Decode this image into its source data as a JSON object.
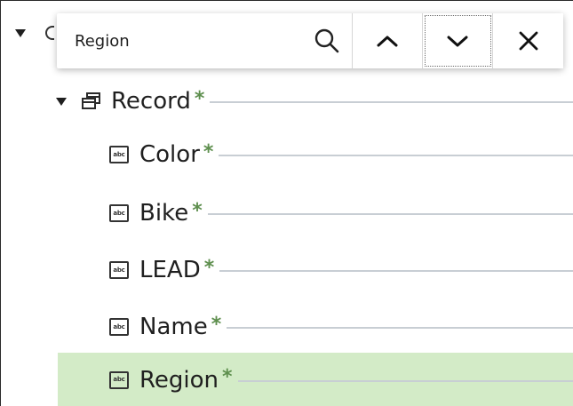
{
  "colors": {
    "selected_row": "#d3ebc7",
    "required_asterisk": "#5e8f4e",
    "leader_line": "#c8ced4"
  },
  "find_bar": {
    "value": "Region",
    "search_icon": "search-icon",
    "prev_icon": "chevron-up-icon",
    "next_icon": "chevron-down-icon",
    "close_icon": "close-icon"
  },
  "tree": {
    "root": {
      "expanded": true
    },
    "record": {
      "label": "Record",
      "required": "*",
      "icon": "record-icon",
      "expanded": true
    },
    "fields": [
      {
        "label": "Color",
        "required": "*",
        "icon": "abc-icon",
        "icon_text": "abc"
      },
      {
        "label": "Bike",
        "required": "*",
        "icon": "abc-icon",
        "icon_text": "abc"
      },
      {
        "label": "LEAD",
        "required": "*",
        "icon": "abc-icon",
        "icon_text": "abc"
      },
      {
        "label": "Name",
        "required": "*",
        "icon": "abc-icon",
        "icon_text": "abc"
      },
      {
        "label": "Region",
        "required": "*",
        "icon": "abc-icon",
        "icon_text": "abc",
        "selected": true
      }
    ]
  }
}
